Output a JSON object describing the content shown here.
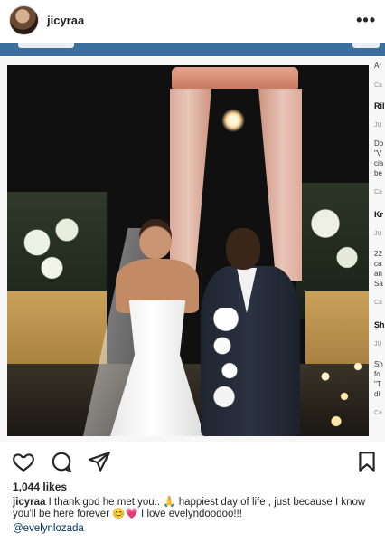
{
  "header": {
    "username": "jicyraa",
    "more_label": "•••"
  },
  "post": {
    "likes": "1,044 likes",
    "caption_user": "jicyraa",
    "caption_text": "I thank god he met you.. 🙏 happiest day of life , just because I know you'll be here forever 😊💗 I love evelyndoodoo!!!",
    "mention": "@evelynlozada"
  },
  "sidebar_snippets": [
    "Ar",
    "Ca",
    "Ril",
    "JU",
    "Do",
    "\"V",
    "cia",
    "be",
    "Ca",
    "Kr",
    "JU",
    "22",
    "ca",
    "an",
    "Sa",
    "Ca",
    "Sh",
    "JU",
    "Sh",
    "fo",
    "\"T",
    "di",
    "Ca"
  ],
  "colors": {
    "frame_topbar": "#3c6e9e",
    "link": "#003569"
  },
  "icons": [
    "heart-icon",
    "comment-icon",
    "share-icon",
    "bookmark-icon",
    "more-icon"
  ]
}
